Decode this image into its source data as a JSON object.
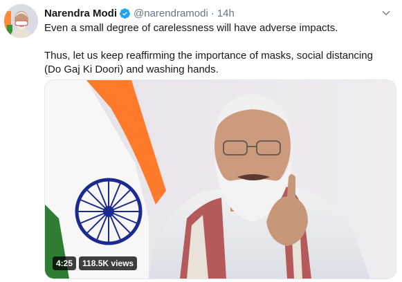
{
  "tweet": {
    "author_name": "Narendra Modi",
    "handle": "@narendramodi",
    "separator": "·",
    "time": "14h",
    "verified_icon": "verified-badge-icon",
    "more_icon": "chevron-down-icon",
    "text_line1": "Even a small degree of carelessness will have adverse impacts.",
    "text_line2": "Thus, let us keep reaffirming the importance of masks, social distancing (Do Gaj Ki Doori) and washing hands."
  },
  "video": {
    "duration": "4:25",
    "views": "118.5K views"
  },
  "colors": {
    "verified_blue": "#1da1f2",
    "handle_gray": "#657786",
    "flag_saffron": "#ff7a2a",
    "flag_green": "#2e7d32",
    "chakra_navy": "#1b2a8f"
  }
}
